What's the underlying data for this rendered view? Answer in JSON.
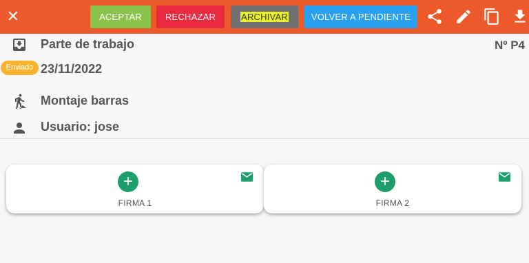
{
  "toolbar": {
    "close_icon": "close-icon",
    "buttons": {
      "aceptar": "ACEPTAR",
      "rechazar": "RECHAZAR",
      "archivar": "ARCHIVAR",
      "volver": "VOLVER A PENDIENTE"
    },
    "icons": [
      "share-icon",
      "edit-icon",
      "copy-icon",
      "download-icon"
    ],
    "colors": {
      "bar": "#ec5a2b",
      "aceptar": "#8bc34a",
      "rechazar": "#ea2a40",
      "archivar": "#707070",
      "volver": "#29a0f0"
    }
  },
  "header": {
    "title": "Parte de trabajo",
    "number": "Nº P4",
    "status_badge": "Enviado",
    "date": "23/11/2022",
    "task": "Montaje barras",
    "user": "Usuario: jose"
  },
  "signatures": [
    {
      "label": "FIRMA 1"
    },
    {
      "label": "FIRMA 2"
    }
  ]
}
